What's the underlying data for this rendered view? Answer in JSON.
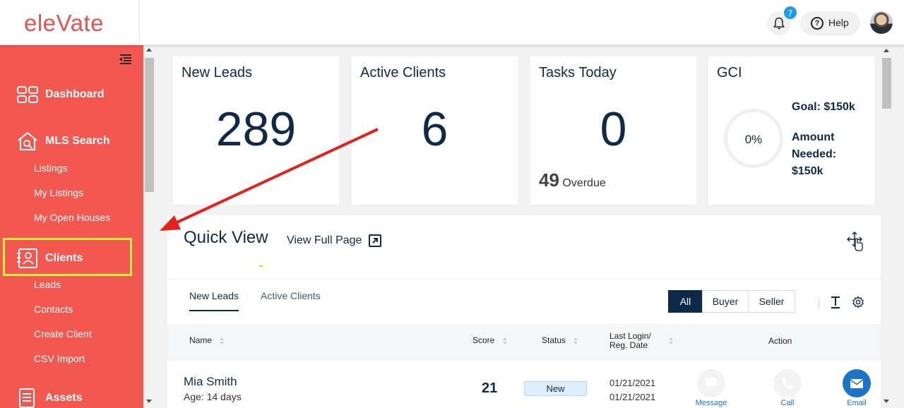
{
  "header": {
    "logo": "eleVate",
    "notification_count": "7",
    "help_label": "Help"
  },
  "sidebar": {
    "items": [
      {
        "label": "Dashboard"
      },
      {
        "label": "MLS Search",
        "children": [
          "Listings",
          "My Listings",
          "My Open Houses"
        ]
      },
      {
        "label": "Clients",
        "children": [
          "Leads",
          "Contacts",
          "Create Client",
          "CSV Import"
        ]
      },
      {
        "label": "Assets"
      }
    ]
  },
  "cards": {
    "new_leads": {
      "title": "New Leads",
      "value": "289"
    },
    "active_clients": {
      "title": "Active Clients",
      "value": "6"
    },
    "tasks_today": {
      "title": "Tasks Today",
      "value": "0",
      "overdue_count": "49",
      "overdue_label": "Overdue"
    },
    "gci": {
      "title": "GCI",
      "percent": "0%",
      "goal": "Goal: $150k",
      "amount_needed": "Amount Needed: $150k"
    }
  },
  "quick_view": {
    "title": "Quick View",
    "full_page_label": "View Full Page",
    "tabs": [
      "New Leads",
      "Active Clients"
    ],
    "filters": [
      "All",
      "Buyer",
      "Seller"
    ],
    "columns": {
      "name": "Name",
      "score": "Score",
      "status": "Status",
      "last_login_1": "Last Login/",
      "last_login_2": "Reg. Date",
      "action": "Action"
    },
    "rows": [
      {
        "name": "Mia Smith",
        "age": "Age: 14 days",
        "score": "21",
        "status": "New",
        "last_login": "01/21/2021",
        "reg_date": "01/21/2021",
        "actions": [
          "Message",
          "Call",
          "Email"
        ]
      }
    ]
  },
  "colors": {
    "sidebar": "#f2584f",
    "navy": "#0f2a48",
    "highlight": "#f6f03a",
    "arrow": "#e8201a",
    "email_button": "#1c74c9"
  }
}
